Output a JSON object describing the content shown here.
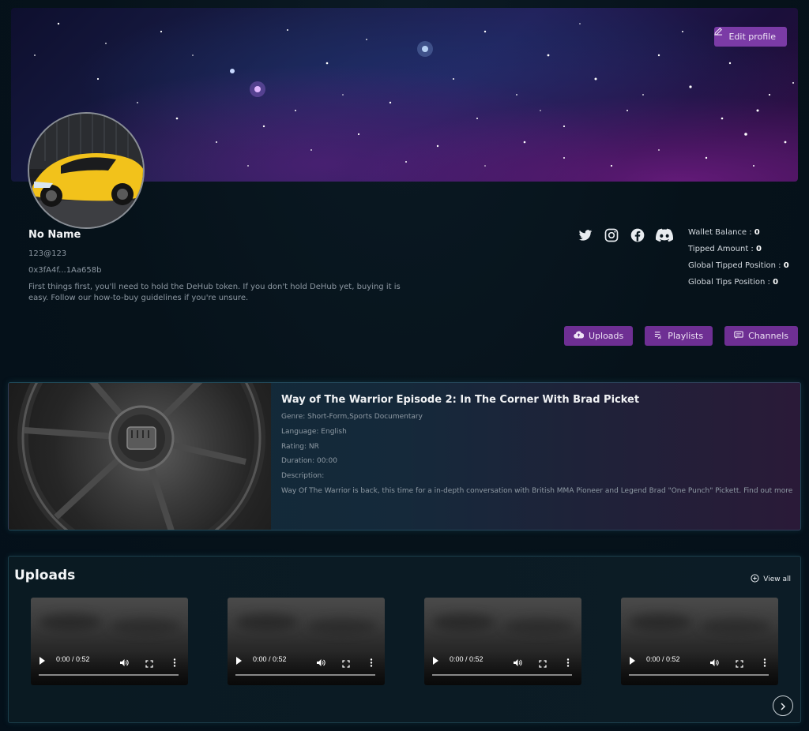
{
  "header": {
    "edit_profile_label": "Edit profile"
  },
  "profile": {
    "name": "No Name",
    "email": "123@123",
    "wallet_address": "0x3fA4f...1Aa658b",
    "bio": "First things first, you'll need to hold the DeHub token. If you don't hold DeHub yet, buying it is easy. Follow our how-to-buy guidelines if you're unsure."
  },
  "socials": [
    {
      "icon": "twitter-icon"
    },
    {
      "icon": "instagram-icon"
    },
    {
      "icon": "facebook-icon"
    },
    {
      "icon": "discord-icon"
    }
  ],
  "stats": {
    "wallet_balance_label": "Wallet Balance : ",
    "wallet_balance": "0",
    "tipped_amount_label": "Tipped Amount : ",
    "tipped_amount": "0",
    "global_tipped_position_label": "Global Tipped Position : ",
    "global_tipped_position": "0",
    "global_tips_position_label": "Global Tips Position : ",
    "global_tips_position": "0"
  },
  "actions": {
    "uploads_label": "Uploads",
    "playlists_label": "Playlists",
    "channels_label": "Channels"
  },
  "featured": {
    "title": "Way of The Warrior Episode 2: In The Corner With Brad Picket",
    "genre": "Genre: Short-Form,Sports Documentary",
    "language": "Language: English",
    "rating": "Rating: NR",
    "duration": "Duration: 00:00",
    "description_label": "Description:",
    "description": "Way Of The Warrior is back, this time for a in-depth conversation with British MMA Pioneer and Legend Brad \"One Punch\" Pickett. Find out more abou..."
  },
  "uploads": {
    "title": "Uploads",
    "view_all_label": "View all",
    "videos": [
      {
        "time": "0:00 / 0:52"
      },
      {
        "time": "0:00 / 0:52"
      },
      {
        "time": "0:00 / 0:52"
      },
      {
        "time": "0:00 / 0:52"
      }
    ]
  },
  "colors": {
    "accent": "#7b3ba6",
    "background": "#06121a"
  }
}
